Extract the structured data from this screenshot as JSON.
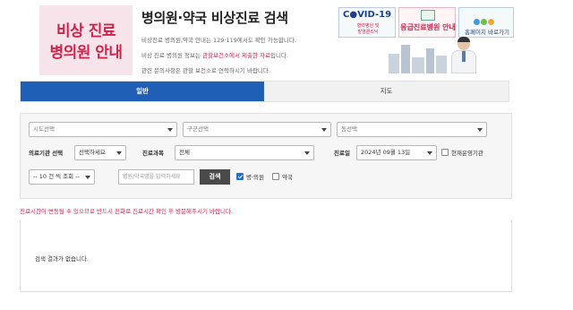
{
  "brand": {
    "line1": "비상 진료",
    "line2": "병의원 안내"
  },
  "header": {
    "title": "병의원·약국 비상진료 검색",
    "info_line1": "비상진료 병의원,약국 안내는 129·119에서도 확인 가능합니다.",
    "info_line2_before": "비상 진료 병의원 정보는 ",
    "info_line2_highlight": "관할보건소에서 제출한 자료",
    "info_line2_after": "입니다.",
    "info_line3": "관련 문의사항은 관할 보건소로 연락하시기 바랍니다."
  },
  "banners": {
    "covid_title": "C●VID-19",
    "covid_sub": "협력병원 및\n발열클리닉",
    "emergency_label": "응급진료병원 안내",
    "home_label": "홈페이지 바로가기"
  },
  "tabs": [
    {
      "label": "일반",
      "active": true
    },
    {
      "label": "지도",
      "active": false
    }
  ],
  "search": {
    "sido": "시도선택",
    "gugun": "구군선택",
    "dong": "동선택",
    "institution_label": "의료기관 선택",
    "institution_value": "선택하세요",
    "department_label": "진료과목",
    "department_value": "전체",
    "date_label": "진료일",
    "date_value": "2024년 09월 13일",
    "operating_now_label": "현재운영기관",
    "operating_now_checked": false,
    "page_size": "-- 10 건 씩 조회 --",
    "keyword_placeholder": "병원/약국명을 입력하세요",
    "search_button": "검색",
    "hospital_label": "병·의원",
    "hospital_checked": true,
    "pharmacy_label": "약국",
    "pharmacy_checked": false
  },
  "notice": "진료시간이 변동될 수 있으므로 반드시 전화로 진료시간 확인 후 방문해주시기 바랍니다.",
  "results": {
    "empty_message": "검색 결과가 없습니다."
  },
  "colors": {
    "accent_red": "#d2224b",
    "tab_blue": "#1f5fb6",
    "button_dark": "#4a4a4a"
  }
}
